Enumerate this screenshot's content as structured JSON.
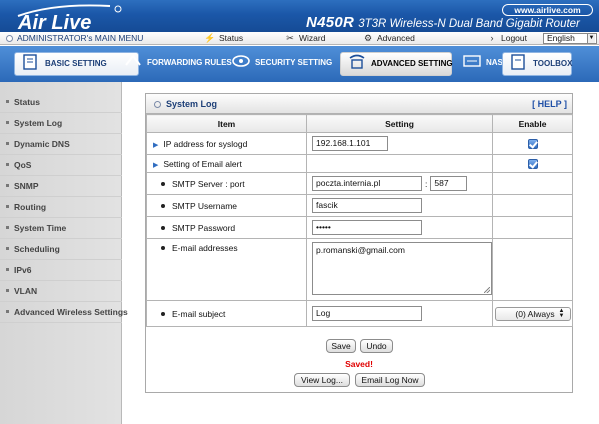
{
  "header": {
    "brand": "Air Live",
    "url": "www.airlive.com",
    "model": "N450R",
    "model_desc": "3T3R Wireless-N Dual Band Gigabit Router"
  },
  "menubar": {
    "admin_label": "ADMINISTRATOR's MAIN MENU",
    "status": "Status",
    "wizard": "Wizard",
    "advanced": "Advanced",
    "logout": "Logout",
    "language": "English"
  },
  "tabs": [
    {
      "label": "BASIC SETTING"
    },
    {
      "label": "FORWARDING RULES"
    },
    {
      "label": "SECURITY SETTING"
    },
    {
      "label": "ADVANCED SETTING"
    },
    {
      "label": "NAS"
    },
    {
      "label": "TOOLBOX"
    }
  ],
  "sidebar": {
    "items": [
      {
        "label": "Status"
      },
      {
        "label": "System Log"
      },
      {
        "label": "Dynamic DNS"
      },
      {
        "label": "QoS"
      },
      {
        "label": "SNMP"
      },
      {
        "label": "Routing"
      },
      {
        "label": "System Time"
      },
      {
        "label": "Scheduling"
      },
      {
        "label": "IPv6"
      },
      {
        "label": "VLAN"
      },
      {
        "label": "Advanced Wireless Settings"
      }
    ]
  },
  "panel": {
    "title": "System Log",
    "help": "[ HELP ]",
    "columns": {
      "item": "Item",
      "setting": "Setting",
      "enable": "Enable"
    },
    "rows": {
      "syslog_ip": {
        "label": "IP address for syslogd",
        "value": "192.168.1.101",
        "enabled": true
      },
      "email_alert": {
        "label": "Setting of Email alert",
        "enabled": true
      },
      "smtp_server": {
        "label": "SMTP Server : port",
        "value": "poczta.internia.pl",
        "port": "587"
      },
      "smtp_user": {
        "label": "SMTP Username",
        "value": "fascik"
      },
      "smtp_pass": {
        "label": "SMTP Password",
        "value": "•••••"
      },
      "email_addr": {
        "label": "E-mail addresses",
        "value": "p.romanski@gmail.com"
      },
      "email_subject": {
        "label": "E-mail subject",
        "value": "Log",
        "schedule": "(0) Always"
      }
    },
    "actions": {
      "save": "Save",
      "undo": "Undo",
      "saved_msg": "Saved!",
      "view_log": "View Log...",
      "email_log": "Email Log Now"
    }
  },
  "colors": {
    "banner": "#1b57a8",
    "tab_row": "#2c69b8",
    "accent_text": "#1d3f77",
    "saved": "#e00000"
  }
}
